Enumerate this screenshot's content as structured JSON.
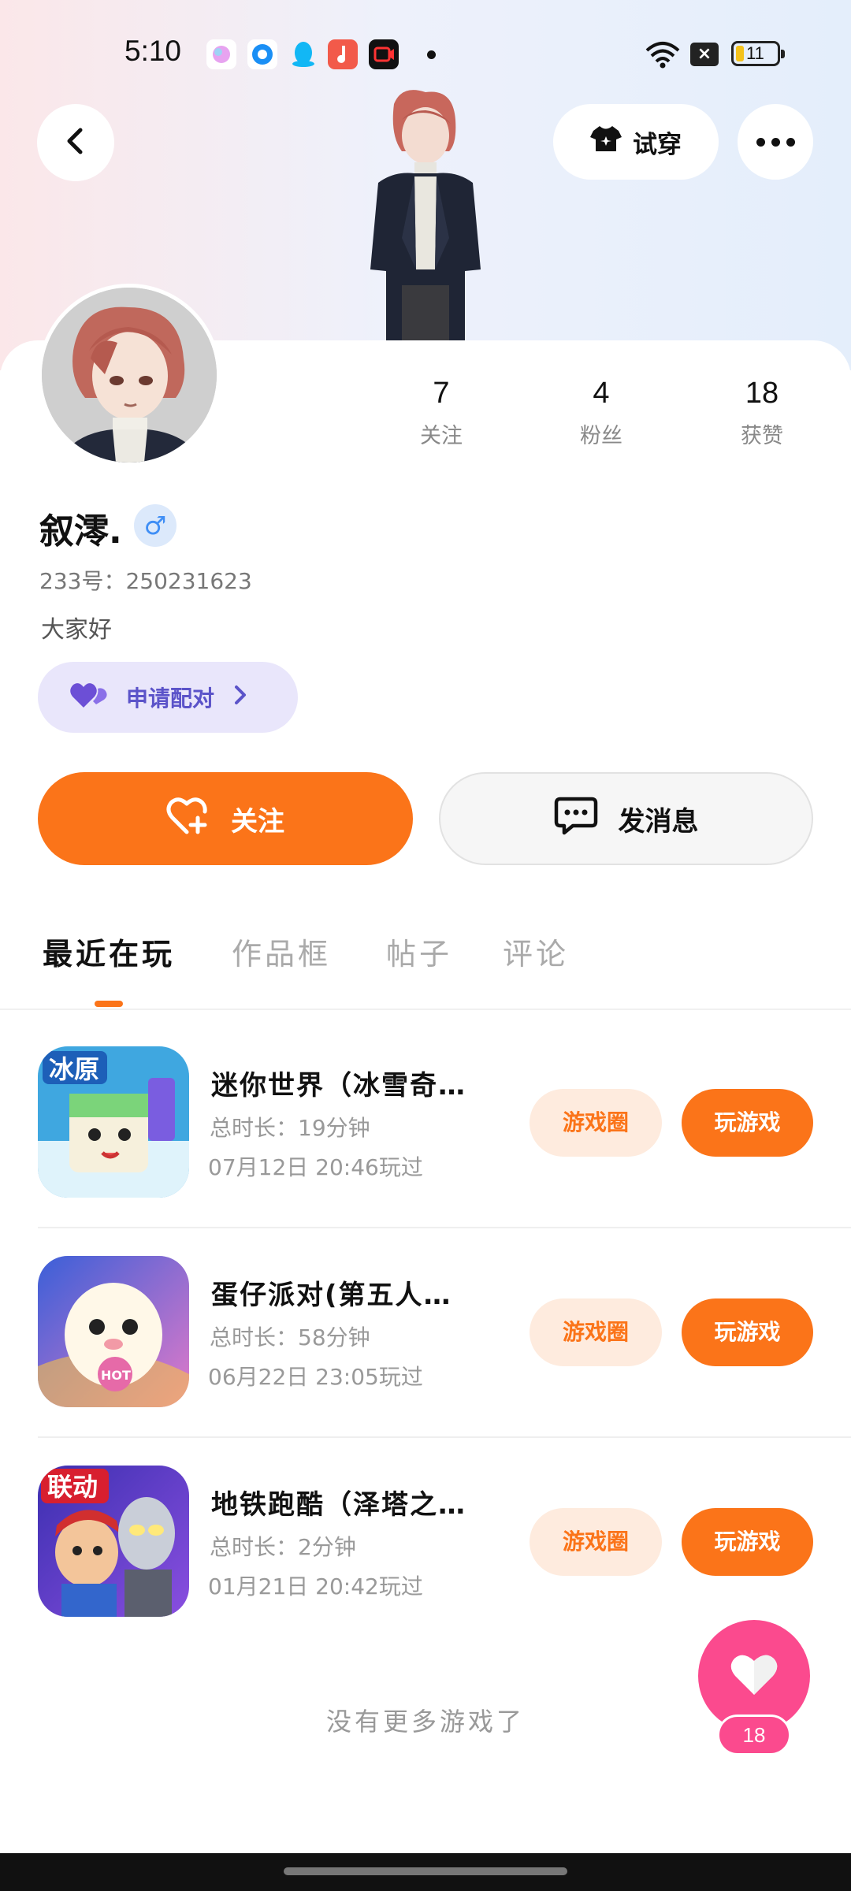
{
  "status_bar": {
    "time": "5:10",
    "battery": "11",
    "icons": [
      "bubble-app-icon",
      "browser-icon",
      "qq-icon",
      "music-icon",
      "video-icon"
    ]
  },
  "header": {
    "back_icon": "chevron-left-icon",
    "try_on_label": "试穿",
    "more_icon": "more-dots-icon"
  },
  "profile": {
    "name": "叙澪.",
    "gender_symbol": "♂",
    "uid": "233号：250231623",
    "bio": "大家好",
    "pair_label": "申请配对"
  },
  "stats": [
    {
      "value": "7",
      "label": "关注"
    },
    {
      "value": "4",
      "label": "粉丝"
    },
    {
      "value": "18",
      "label": "获赞"
    }
  ],
  "actions": {
    "follow_label": "关注",
    "message_label": "发消息"
  },
  "tabs": [
    {
      "label": "最近在玩",
      "active": true
    },
    {
      "label": "作品框",
      "active": false
    },
    {
      "label": "帖子",
      "active": false
    },
    {
      "label": "评论",
      "active": false
    }
  ],
  "games": [
    {
      "title": "迷你世界（冰雪奇…",
      "duration": "总时长：19分钟",
      "last_played": "07月12日 20:46玩过",
      "circle_label": "游戏圈",
      "play_label": "玩游戏",
      "icon_text": "冰原"
    },
    {
      "title": "蛋仔派对(第五人…",
      "duration": "总时长：58分钟",
      "last_played": "06月22日 23:05玩过",
      "circle_label": "游戏圈",
      "play_label": "玩游戏",
      "icon_text": "HOT"
    },
    {
      "title": "地铁跑酷（泽塔之…",
      "duration": "总时长：2分钟",
      "last_played": "01月21日 20:42玩过",
      "circle_label": "游戏圈",
      "play_label": "玩游戏",
      "icon_text": "联动"
    }
  ],
  "footer": {
    "no_more": "没有更多游戏了",
    "like_count": "18"
  },
  "colors": {
    "accent": "#fb7419",
    "accent_light": "#feebde",
    "like_pink": "#fb4a8e",
    "pair_bg": "#e9e6fb",
    "pair_text": "#5b53c9"
  }
}
